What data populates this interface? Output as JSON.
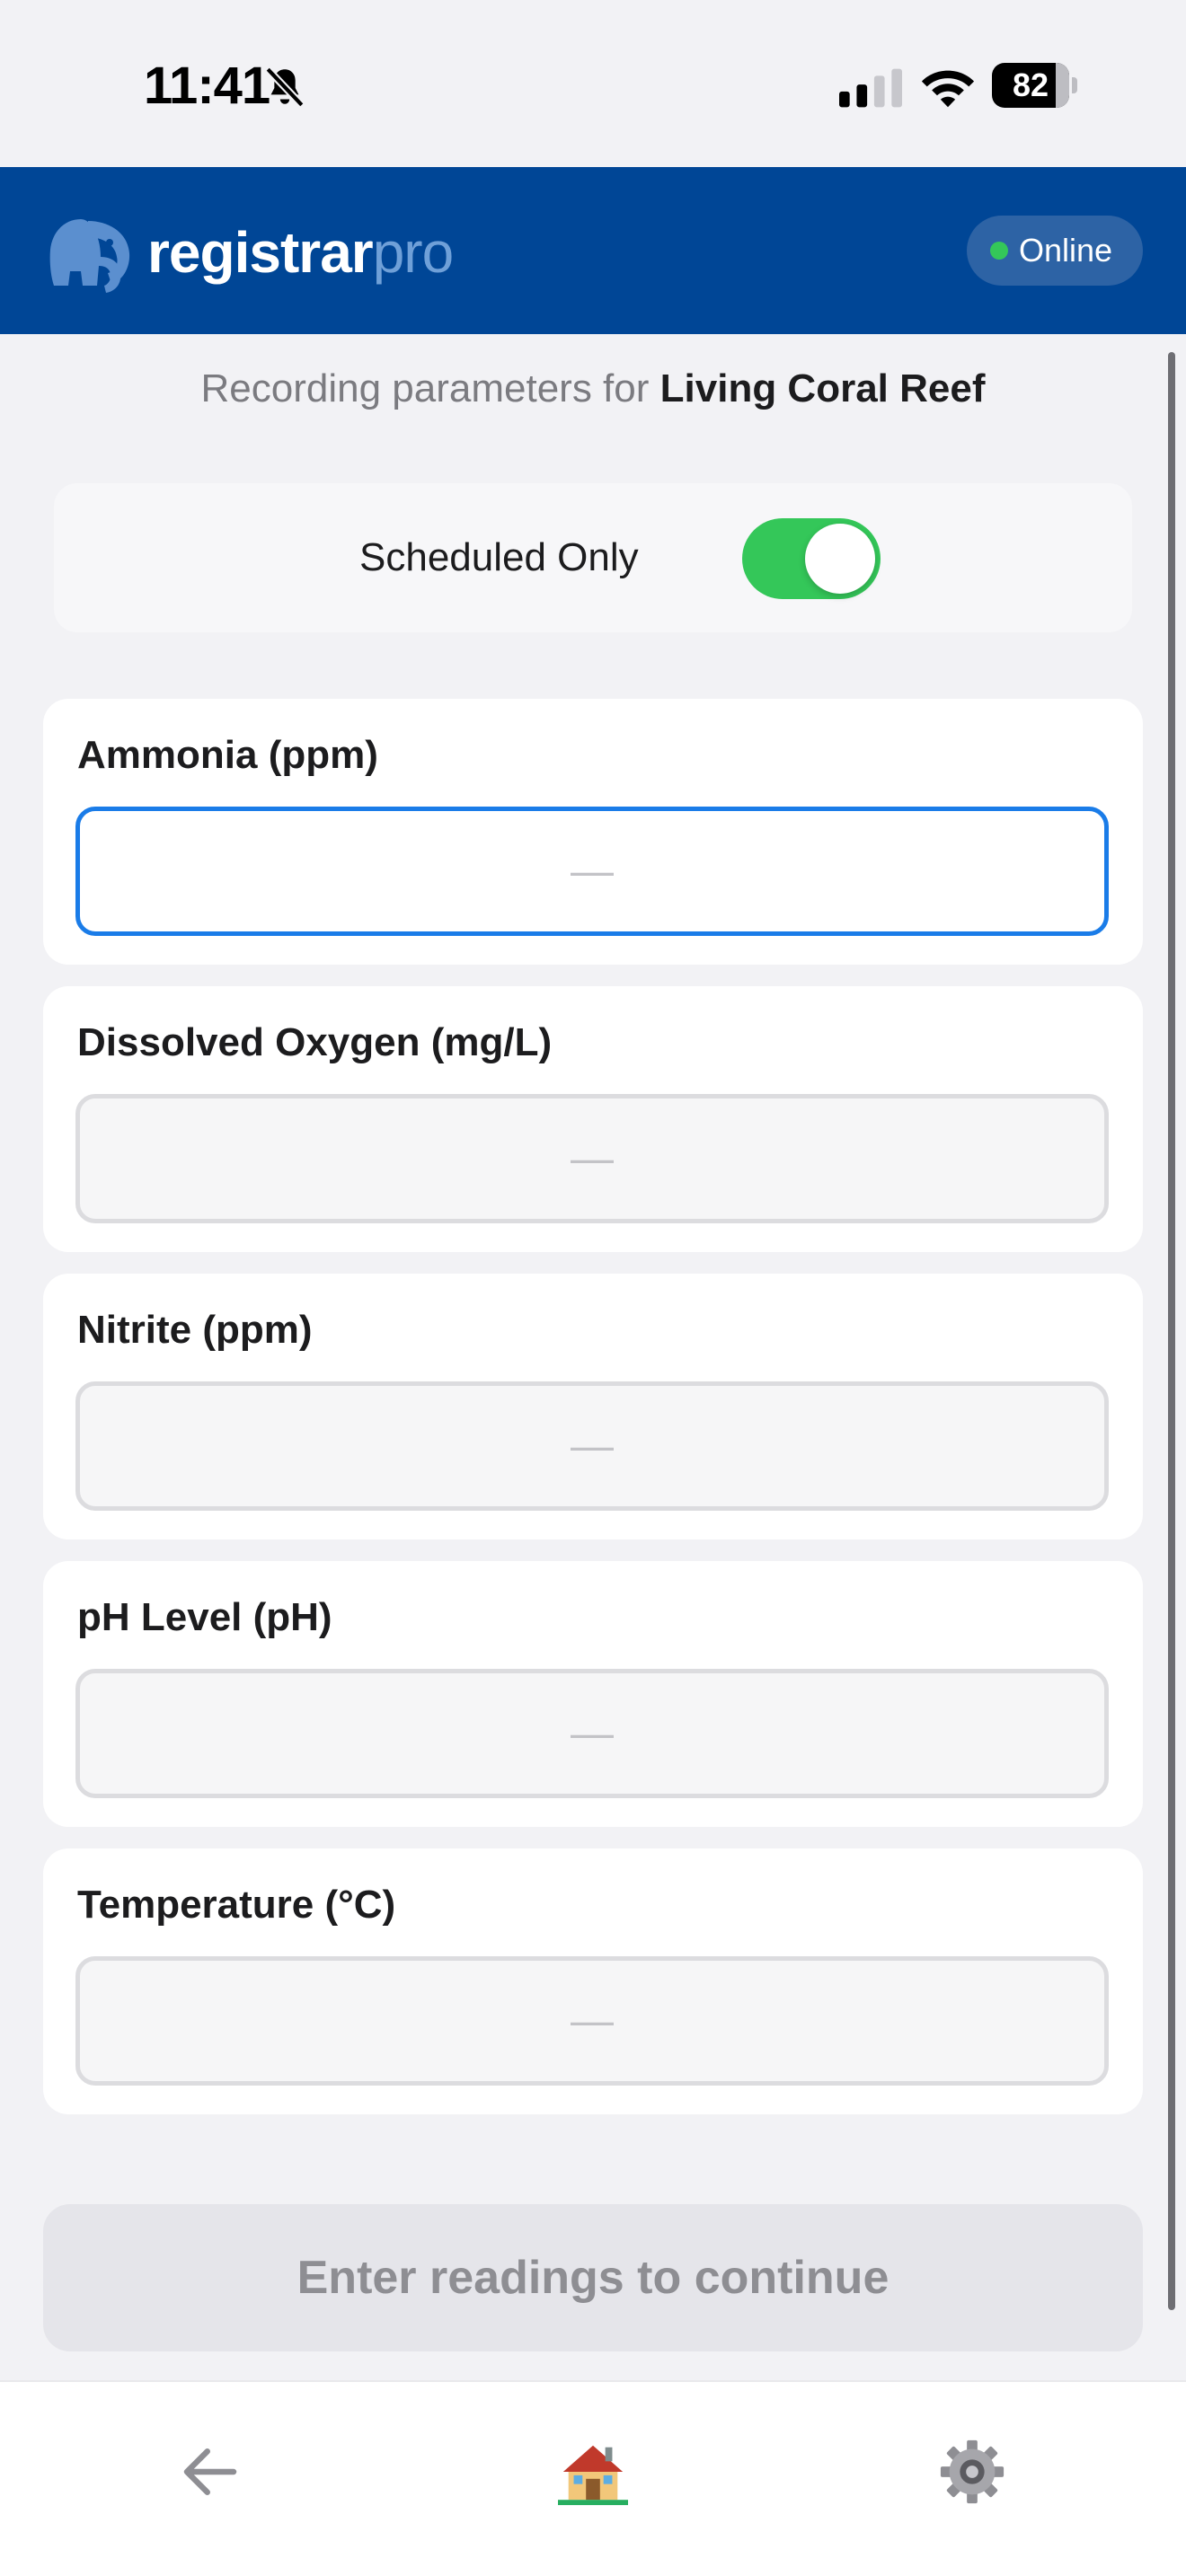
{
  "status_bar": {
    "time": "11:41",
    "battery": 82,
    "icons": [
      "bell-slash-icon",
      "signal-icon",
      "wifi-icon",
      "battery-icon"
    ]
  },
  "header": {
    "brand_main": "registrar",
    "brand_accent": "pro",
    "status_label": "Online",
    "colors": {
      "background": "#004696",
      "status_dot": "#34c759"
    }
  },
  "recording": {
    "prefix": "Recording parameters for",
    "site_name": "Living Coral Reef"
  },
  "schedule_toggle": {
    "label": "Scheduled Only",
    "enabled": true
  },
  "parameters": [
    {
      "label": "Ammonia (ppm)",
      "placeholder": "—",
      "focused": true
    },
    {
      "label": "Dissolved Oxygen (mg/L)",
      "placeholder": "—",
      "focused": false
    },
    {
      "label": "Nitrite (ppm)",
      "placeholder": "—",
      "focused": false
    },
    {
      "label": "pH Level (pH)",
      "placeholder": "—",
      "focused": false
    },
    {
      "label": "Temperature (°C)",
      "placeholder": "—",
      "focused": false
    }
  ],
  "continue_button": {
    "label": "Enter readings to continue",
    "disabled": true
  },
  "bottom_nav": {
    "items": [
      {
        "icon": "back-arrow-icon"
      },
      {
        "icon": "home-icon"
      },
      {
        "icon": "gear-icon"
      }
    ]
  }
}
